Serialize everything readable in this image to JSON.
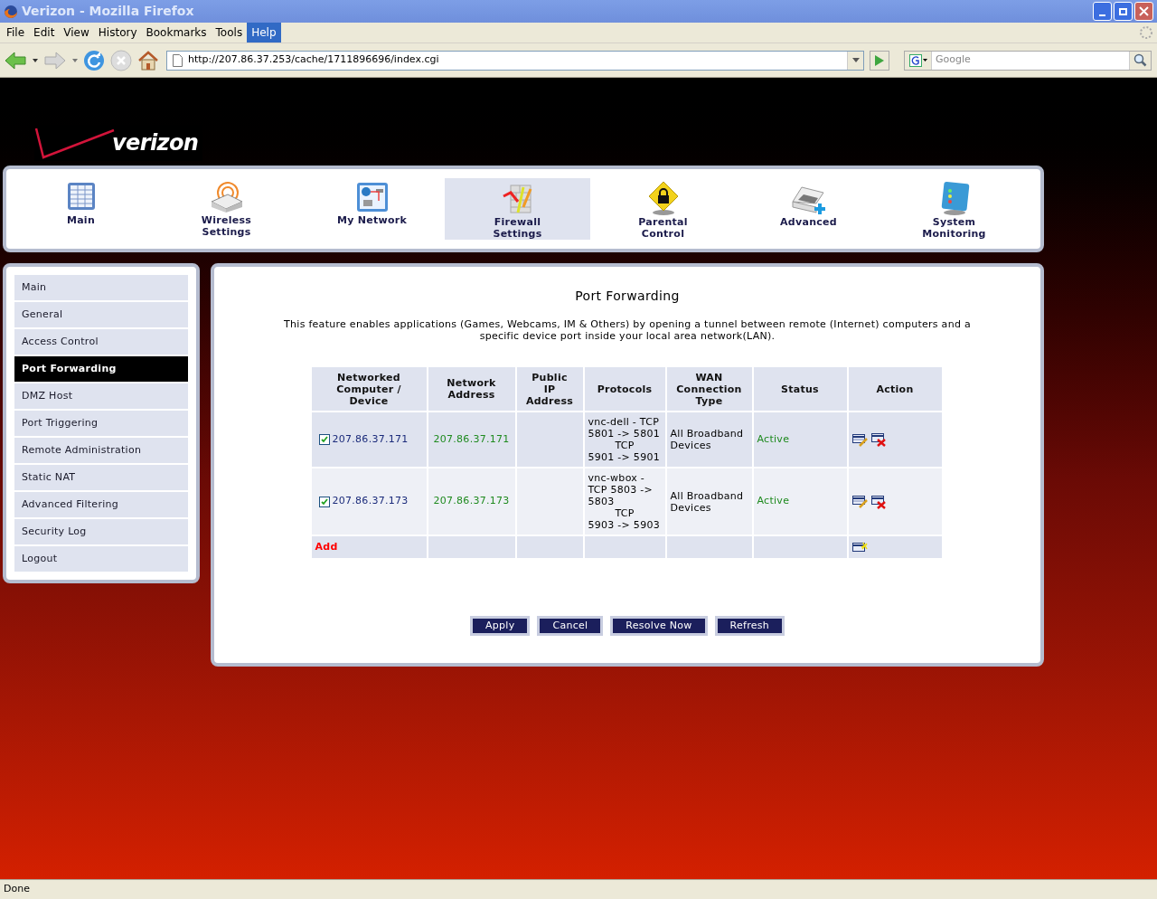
{
  "window": {
    "title": "Verizon - Mozilla Firefox"
  },
  "menu": [
    {
      "label": "File",
      "selected": false
    },
    {
      "label": "Edit",
      "selected": false
    },
    {
      "label": "View",
      "selected": false
    },
    {
      "label": "History",
      "selected": false
    },
    {
      "label": "Bookmarks",
      "selected": false
    },
    {
      "label": "Tools",
      "selected": false
    },
    {
      "label": "Help",
      "selected": true
    }
  ],
  "address_bar": {
    "value": "http://207.86.37.253/cache/1711896696/index.cgi"
  },
  "search": {
    "placeholder": "Google"
  },
  "logo": {
    "text": "verizon"
  },
  "nav": [
    {
      "label": "Main",
      "kind": "main",
      "selected": false
    },
    {
      "label": "Wireless Settings",
      "kind": "wireless",
      "selected": false
    },
    {
      "label": "My Network",
      "kind": "network",
      "selected": false
    },
    {
      "label": "Firewall Settings",
      "kind": "firewall",
      "selected": true
    },
    {
      "label": "Parental Control",
      "kind": "parental",
      "selected": false
    },
    {
      "label": "Advanced",
      "kind": "advanced",
      "selected": false
    },
    {
      "label": "System Monitoring",
      "kind": "monitoring",
      "selected": false
    }
  ],
  "sidebar": {
    "items": [
      {
        "label": "Main",
        "selected": false
      },
      {
        "label": "General",
        "selected": false
      },
      {
        "label": "Access Control",
        "selected": false
      },
      {
        "label": "Port Forwarding",
        "selected": true
      },
      {
        "label": "DMZ Host",
        "selected": false
      },
      {
        "label": "Port Triggering",
        "selected": false
      },
      {
        "label": "Remote Administration",
        "selected": false
      },
      {
        "label": "Static NAT",
        "selected": false
      },
      {
        "label": "Advanced Filtering",
        "selected": false
      },
      {
        "label": "Security Log",
        "selected": false
      },
      {
        "label": "Logout",
        "selected": false
      }
    ]
  },
  "panel": {
    "title": "Port Forwarding",
    "description": "This feature enables applications (Games, Webcams, IM & Others) by opening a tunnel between remote (Internet) computers and a specific device port inside your local area network(LAN)."
  },
  "table": {
    "columns": [
      "Networked Computer / Device",
      "Network Address",
      "Public IP Address",
      "Protocols",
      "WAN Connection Type",
      "Status",
      "Action"
    ],
    "rows": [
      {
        "checked": true,
        "device": "207.86.37.171",
        "address": "207.86.37.171",
        "protocols": [
          {
            "text": "vnc-dell - TCP",
            "kind": "plain"
          },
          {
            "text": "5801 -> 5801",
            "kind": "plain"
          },
          {
            "text": "TCP",
            "kind": "centered"
          },
          {
            "text": "5901 -> 5901",
            "kind": "plain"
          }
        ],
        "wan": "All Broadband Devices",
        "status": "Active"
      },
      {
        "checked": true,
        "device": "207.86.37.173",
        "address": "207.86.37.173",
        "protocols": [
          {
            "text": "vnc-wbox -",
            "kind": "plain"
          },
          {
            "text": "TCP 5803 ->",
            "kind": "plain"
          },
          {
            "text": "5803",
            "kind": "plain"
          },
          {
            "text": "TCP",
            "kind": "centered"
          },
          {
            "text": "5903 -> 5903",
            "kind": "plain"
          }
        ],
        "wan": "All Broadband Devices",
        "status": "Active"
      }
    ],
    "add_label": "Add"
  },
  "buttons": [
    "Apply",
    "Cancel",
    "Resolve Now",
    "Refresh"
  ],
  "status_bar": {
    "text": "Done"
  }
}
